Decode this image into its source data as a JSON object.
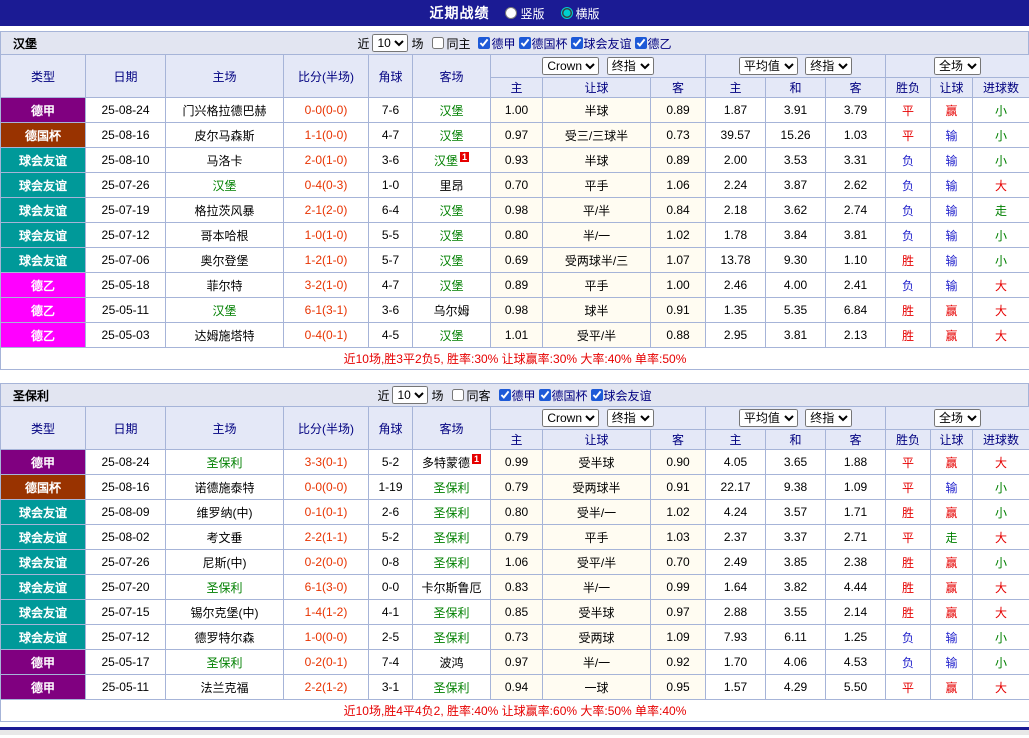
{
  "topbar": {
    "title": "近期战绩",
    "layout_vertical": "竖版",
    "layout_horizontal": "横版"
  },
  "filter_labels": {
    "near": "近",
    "matches": "场"
  },
  "table": {
    "headers": {
      "type": "类型",
      "date": "日期",
      "home": "主场",
      "score": "比分(半场)",
      "corner": "角球",
      "away": "客场",
      "host": "主",
      "handicap": "让球",
      "guest": "客",
      "avg_home": "主",
      "avg_draw": "和",
      "avg_away": "客",
      "wdl": "胜负",
      "handicap_result": "让球",
      "goals": "进球数"
    },
    "selects": {
      "company": "Crown",
      "final_odds_1": "终指",
      "average": "平均值",
      "final_odds_2": "终指",
      "full_match": "全场"
    }
  },
  "colors": {
    "type": {
      "德甲": "#800080",
      "德国杯": "#993300",
      "球会友谊": "#009999",
      "德乙": "#ff00ff"
    },
    "result": {
      "胜": "#e60000",
      "平": "#e60000",
      "负": "#2222cc",
      "赢": "#e60000",
      "输": "#2222cc",
      "走": "#008000",
      "大": "#e60000",
      "小": "#008000"
    },
    "focus_team": "#008000",
    "score": "#e83300"
  },
  "sections": [
    {
      "team": "汉堡",
      "filter": {
        "count": "10",
        "same_label": "同主",
        "leagues": [
          "德甲",
          "德国杯",
          "球会友谊",
          "德乙"
        ]
      },
      "rows": [
        {
          "type": "德甲",
          "date": "25-08-24",
          "home": "门兴格拉德巴赫",
          "home_focus": false,
          "score": "0-0(0-0)",
          "corner": "7-6",
          "away": "汉堡",
          "away_focus": true,
          "odds": [
            "1.00",
            "半球",
            "0.89",
            "1.87",
            "3.91",
            "3.79"
          ],
          "results": [
            "平",
            "赢",
            "小"
          ]
        },
        {
          "type": "德国杯",
          "date": "25-08-16",
          "home": "皮尔马森斯",
          "home_focus": false,
          "score": "1-1(0-0)",
          "corner": "4-7",
          "away": "汉堡",
          "away_focus": true,
          "odds": [
            "0.97",
            "受三/三球半",
            "0.73",
            "39.57",
            "15.26",
            "1.03"
          ],
          "results": [
            "平",
            "输",
            "小"
          ]
        },
        {
          "type": "球会友谊",
          "date": "25-08-10",
          "home": "马洛卡",
          "home_focus": false,
          "score": "2-0(1-0)",
          "corner": "3-6",
          "away": "汉堡",
          "away_focus": true,
          "away_card": "1",
          "odds": [
            "0.93",
            "半球",
            "0.89",
            "2.00",
            "3.53",
            "3.31"
          ],
          "results": [
            "负",
            "输",
            "小"
          ]
        },
        {
          "type": "球会友谊",
          "date": "25-07-26",
          "home": "汉堡",
          "home_focus": true,
          "score": "0-4(0-3)",
          "corner": "1-0",
          "away": "里昂",
          "away_focus": false,
          "odds": [
            "0.70",
            "平手",
            "1.06",
            "2.24",
            "3.87",
            "2.62"
          ],
          "results": [
            "负",
            "输",
            "大"
          ]
        },
        {
          "type": "球会友谊",
          "date": "25-07-19",
          "home": "格拉茨风暴",
          "home_focus": false,
          "score": "2-1(2-0)",
          "corner": "6-4",
          "away": "汉堡",
          "away_focus": true,
          "odds": [
            "0.98",
            "平/半",
            "0.84",
            "2.18",
            "3.62",
            "2.74"
          ],
          "results": [
            "负",
            "输",
            "走"
          ]
        },
        {
          "type": "球会友谊",
          "date": "25-07-12",
          "home": "哥本哈根",
          "home_focus": false,
          "score": "1-0(1-0)",
          "corner": "5-5",
          "away": "汉堡",
          "away_focus": true,
          "odds": [
            "0.80",
            "半/一",
            "1.02",
            "1.78",
            "3.84",
            "3.81"
          ],
          "results": [
            "负",
            "输",
            "小"
          ]
        },
        {
          "type": "球会友谊",
          "date": "25-07-06",
          "home": "奥尔登堡",
          "home_focus": false,
          "score": "1-2(1-0)",
          "corner": "5-7",
          "away": "汉堡",
          "away_focus": true,
          "odds": [
            "0.69",
            "受两球半/三",
            "1.07",
            "13.78",
            "9.30",
            "1.10"
          ],
          "results": [
            "胜",
            "输",
            "小"
          ]
        },
        {
          "type": "德乙",
          "date": "25-05-18",
          "home": "菲尔特",
          "home_focus": false,
          "score": "3-2(1-0)",
          "corner": "4-7",
          "away": "汉堡",
          "away_focus": true,
          "odds": [
            "0.89",
            "平手",
            "1.00",
            "2.46",
            "4.00",
            "2.41"
          ],
          "results": [
            "负",
            "输",
            "大"
          ]
        },
        {
          "type": "德乙",
          "date": "25-05-11",
          "home": "汉堡",
          "home_focus": true,
          "score": "6-1(3-1)",
          "corner": "3-6",
          "away": "乌尔姆",
          "away_focus": false,
          "odds": [
            "0.98",
            "球半",
            "0.91",
            "1.35",
            "5.35",
            "6.84"
          ],
          "results": [
            "胜",
            "赢",
            "大"
          ]
        },
        {
          "type": "德乙",
          "date": "25-05-03",
          "home": "达姆施塔特",
          "home_focus": false,
          "score": "0-4(0-1)",
          "corner": "4-5",
          "away": "汉堡",
          "away_focus": true,
          "odds": [
            "1.01",
            "受平/半",
            "0.88",
            "2.95",
            "3.81",
            "2.13"
          ],
          "results": [
            "胜",
            "赢",
            "大"
          ]
        }
      ],
      "summary": "近10场,胜3平2负5, 胜率:30% 让球赢率:30% 大率:40% 单率:50%"
    },
    {
      "team": "圣保利",
      "filter": {
        "count": "10",
        "same_label": "同客",
        "leagues": [
          "德甲",
          "德国杯",
          "球会友谊"
        ]
      },
      "rows": [
        {
          "type": "德甲",
          "date": "25-08-24",
          "home": "圣保利",
          "home_focus": true,
          "score": "3-3(0-1)",
          "corner": "5-2",
          "away": "多特蒙德",
          "away_focus": false,
          "away_card": "1",
          "odds": [
            "0.99",
            "受半球",
            "0.90",
            "4.05",
            "3.65",
            "1.88"
          ],
          "results": [
            "平",
            "赢",
            "大"
          ]
        },
        {
          "type": "德国杯",
          "date": "25-08-16",
          "home": "诺德施泰特",
          "home_focus": false,
          "score": "0-0(0-0)",
          "corner": "1-19",
          "away": "圣保利",
          "away_focus": true,
          "odds": [
            "0.79",
            "受两球半",
            "0.91",
            "22.17",
            "9.38",
            "1.09"
          ],
          "results": [
            "平",
            "输",
            "小"
          ]
        },
        {
          "type": "球会友谊",
          "date": "25-08-09",
          "home": "维罗纳(中)",
          "home_focus": false,
          "score": "0-1(0-1)",
          "corner": "2-6",
          "away": "圣保利",
          "away_focus": true,
          "odds": [
            "0.80",
            "受半/一",
            "1.02",
            "4.24",
            "3.57",
            "1.71"
          ],
          "results": [
            "胜",
            "赢",
            "小"
          ]
        },
        {
          "type": "球会友谊",
          "date": "25-08-02",
          "home": "考文垂",
          "home_focus": false,
          "score": "2-2(1-1)",
          "corner": "5-2",
          "away": "圣保利",
          "away_focus": true,
          "odds": [
            "0.79",
            "平手",
            "1.03",
            "2.37",
            "3.37",
            "2.71"
          ],
          "results": [
            "平",
            "走",
            "大"
          ]
        },
        {
          "type": "球会友谊",
          "date": "25-07-26",
          "home": "尼斯(中)",
          "home_focus": false,
          "score": "0-2(0-0)",
          "corner": "0-8",
          "away": "圣保利",
          "away_focus": true,
          "odds": [
            "1.06",
            "受平/半",
            "0.70",
            "2.49",
            "3.85",
            "2.38"
          ],
          "results": [
            "胜",
            "赢",
            "小"
          ]
        },
        {
          "type": "球会友谊",
          "date": "25-07-20",
          "home": "圣保利",
          "home_focus": true,
          "score": "6-1(3-0)",
          "corner": "0-0",
          "away": "卡尔斯鲁厄",
          "away_focus": false,
          "odds": [
            "0.83",
            "半/一",
            "0.99",
            "1.64",
            "3.82",
            "4.44"
          ],
          "results": [
            "胜",
            "赢",
            "大"
          ]
        },
        {
          "type": "球会友谊",
          "date": "25-07-15",
          "home": "锡尔克堡(中)",
          "home_focus": false,
          "score": "1-4(1-2)",
          "corner": "4-1",
          "away": "圣保利",
          "away_focus": true,
          "odds": [
            "0.85",
            "受半球",
            "0.97",
            "2.88",
            "3.55",
            "2.14"
          ],
          "results": [
            "胜",
            "赢",
            "大"
          ]
        },
        {
          "type": "球会友谊",
          "date": "25-07-12",
          "home": "德罗特尔森",
          "home_focus": false,
          "score": "1-0(0-0)",
          "corner": "2-5",
          "away": "圣保利",
          "away_focus": true,
          "odds": [
            "0.73",
            "受两球",
            "1.09",
            "7.93",
            "6.11",
            "1.25"
          ],
          "results": [
            "负",
            "输",
            "小"
          ]
        },
        {
          "type": "德甲",
          "date": "25-05-17",
          "home": "圣保利",
          "home_focus": true,
          "score": "0-2(0-1)",
          "corner": "7-4",
          "away": "波鸿",
          "away_focus": false,
          "odds": [
            "0.97",
            "半/一",
            "0.92",
            "1.70",
            "4.06",
            "4.53"
          ],
          "results": [
            "负",
            "输",
            "小"
          ]
        },
        {
          "type": "德甲",
          "date": "25-05-11",
          "home": "法兰克福",
          "home_focus": false,
          "score": "2-2(1-2)",
          "corner": "3-1",
          "away": "圣保利",
          "away_focus": true,
          "odds": [
            "0.94",
            "一球",
            "0.95",
            "1.57",
            "4.29",
            "5.50"
          ],
          "results": [
            "平",
            "赢",
            "大"
          ]
        }
      ],
      "summary": "近10场,胜4平4负2, 胜率:40% 让球赢率:60% 大率:50% 单率:40%"
    }
  ]
}
